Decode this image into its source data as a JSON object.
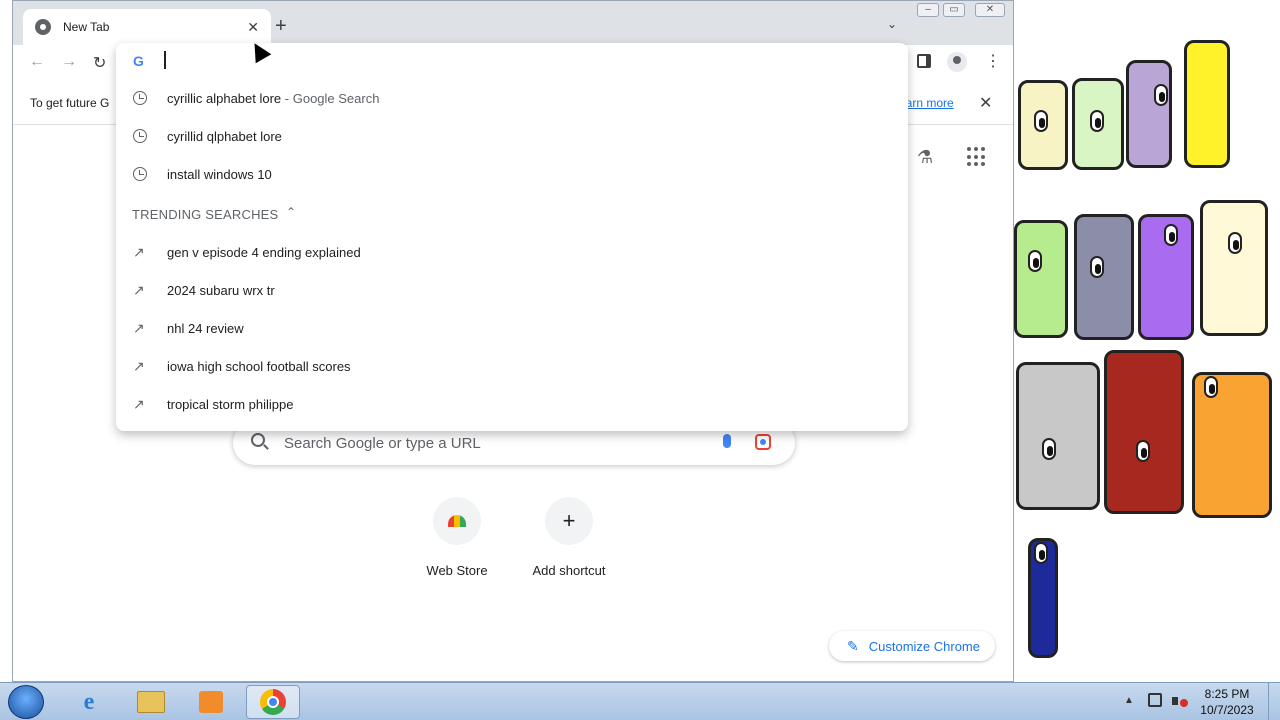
{
  "browser": {
    "tab_title": "New Tab",
    "new_tab_symbol": "+",
    "close_symbol": "✕"
  },
  "omnibox": {
    "value": "",
    "suggestions": [
      {
        "text": "cyrillic alphabet lore",
        "suffix": " - Google Search",
        "icon": "history-clock-icon"
      },
      {
        "text": "cyrillid qlphabet lore",
        "suffix": "",
        "icon": "history-clock-icon"
      },
      {
        "text": "install windows 10",
        "suffix": "",
        "icon": "history-clock-icon"
      }
    ],
    "trending_header": "TRENDING SEARCHES",
    "trending": [
      {
        "text": "gen v episode 4 ending explained",
        "icon": "trending-arrow-icon"
      },
      {
        "text": "2024 subaru wrx tr",
        "icon": "trending-arrow-icon"
      },
      {
        "text": "nhl 24 review",
        "icon": "trending-arrow-icon"
      },
      {
        "text": "iowa high school football scores",
        "icon": "trending-arrow-icon"
      },
      {
        "text": "tropical storm philippe",
        "icon": "trending-arrow-icon"
      }
    ]
  },
  "infobar": {
    "text": "To get future G",
    "link": "earn more"
  },
  "ntp": {
    "search_placeholder": "Search Google or type a URL",
    "shortcuts": [
      {
        "label": "Web Store",
        "icon": "web-store-icon"
      },
      {
        "label": "Add shortcut",
        "icon": "plus-icon",
        "glyph": "+"
      }
    ],
    "customize_label": "Customize Chrome"
  },
  "taskbar": {
    "apps": [
      "internet-explorer",
      "file-explorer",
      "media-player",
      "google-chrome"
    ],
    "active_app": "google-chrome",
    "time": "8:25 PM",
    "date": "10/7/2023"
  },
  "colors": {
    "accent": "#1a73e8",
    "titlebar": "#dee1e6",
    "taskbar": "#b9d1ea"
  }
}
